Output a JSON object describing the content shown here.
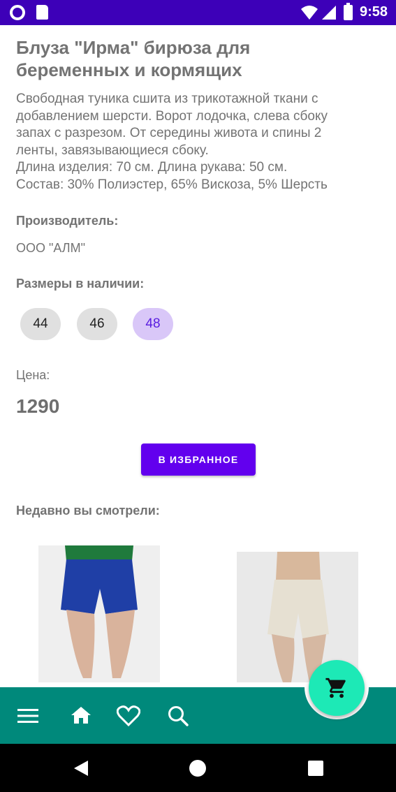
{
  "status_bar": {
    "time": "9:58"
  },
  "product": {
    "title_lines": [
      "Блуза \"Ирма\" бирюза для",
      "беременных и кормящих"
    ],
    "description_lines": [
      "Свободная туника сшита из трикотажной ткани с",
      "добавлением шерсти. Ворот лодочка, слева сбоку",
      "запах с разрезом. От середины живота и спины 2",
      "ленты, завязывающиеся сбоку.",
      "Длина изделия: 70 см. Длина рукава: 50 см.",
      "Состав: 30% Полиэстер, 65% Вискоза, 5% Шерсть"
    ],
    "manufacturer_label": "Производитель:",
    "manufacturer": "ООО \"АЛМ\"",
    "sizes_label": "Размеры в наличии:",
    "sizes": [
      "44",
      "46",
      "48"
    ],
    "selected_size": "48",
    "price_label": "Цена:",
    "price": "1290",
    "favorite_button": "В ИЗБРАННОЕ"
  },
  "recent": {
    "label": "Недавно вы смотрели:",
    "items": [
      {
        "image": "blue-maternity-shorts"
      },
      {
        "image": "beige-maternity-shorts"
      }
    ]
  },
  "bottom_bar": {
    "icons": [
      "menu-icon",
      "home-icon",
      "heart-icon",
      "search-icon"
    ],
    "fab_icon": "cart-icon",
    "color": "#00897b",
    "fab_color": "#1de9b6"
  },
  "colors": {
    "status_bar": "#3d00b8",
    "accent": "#6200ee",
    "chip_selected_bg": "#d9c7f8"
  }
}
